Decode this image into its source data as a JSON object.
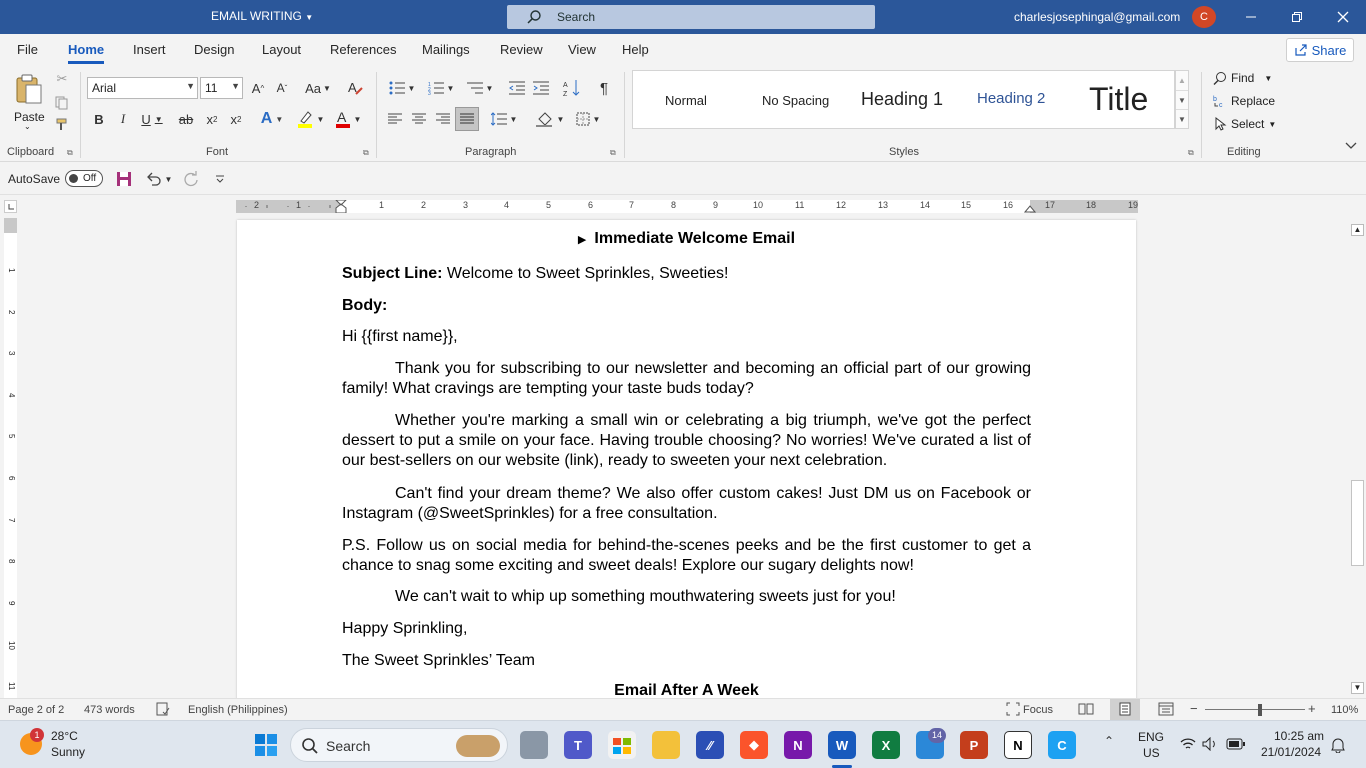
{
  "title_bar": {
    "doc_title": "EMAIL WRITING",
    "search_placeholder": "Search",
    "account_email": "charlesjosephingal@gmail.com",
    "avatar_initial": "C"
  },
  "menu": {
    "tabs": [
      "File",
      "Home",
      "Insert",
      "Design",
      "Layout",
      "References",
      "Mailings",
      "Review",
      "View",
      "Help"
    ],
    "active": "Home",
    "share_label": "Share"
  },
  "ribbon": {
    "clipboard": {
      "paste_label": "Paste",
      "group_label": "Clipboard"
    },
    "font": {
      "family": "Arial",
      "size": "11",
      "group_label": "Font"
    },
    "paragraph": {
      "group_label": "Paragraph"
    },
    "styles": {
      "items": [
        "Normal",
        "No Spacing",
        "Heading 1",
        "Heading 2",
        "Title"
      ],
      "group_label": "Styles"
    },
    "editing": {
      "find": "Find",
      "replace": "Replace",
      "select": "Select",
      "group_label": "Editing"
    }
  },
  "qat": {
    "autosave_label": "AutoSave",
    "autosave_state": "Off"
  },
  "ruler": {
    "numbers": [
      "2",
      "1",
      "",
      "1",
      "2",
      "3",
      "4",
      "5",
      "6",
      "7",
      "8",
      "9",
      "10",
      "11",
      "12",
      "13",
      "14",
      "15",
      "16",
      "17",
      "18",
      "19"
    ]
  },
  "vruler": {
    "numbers": [
      "1",
      "2",
      "3",
      "4",
      "5",
      "6",
      "7",
      "8",
      "9",
      "10",
      "11"
    ]
  },
  "document": {
    "heading_top": "Immediate Welcome Email",
    "subject_label": "Subject Line:",
    "subject_text": " Welcome to Sweet Sprinkles, Sweeties!",
    "body_label": "Body:",
    "greeting": "Hi {{first name}},",
    "p1": "Thank you for subscribing to our newsletter and becoming an official part of our growing family! What cravings are tempting your taste buds today?",
    "p2": "Whether you're marking a small win or celebrating a big triumph, we've got the perfect dessert to put a smile on your face. Having trouble choosing? No worries! We've curated a list of our best-sellers on our website (link), ready to sweeten your next celebration.",
    "p3": "Can't find your dream theme? We also offer custom cakes! Just DM us on Facebook or Instagram (@SweetSprinkles) for a free consultation.",
    "p4": "P.S. Follow us on social media for behind-the-scenes peeks and be the first customer to get a chance to snag some exciting and sweet deals! Explore our sugary delights now!",
    "p5": "We can't wait to whip up something mouthwatering sweets just for you!",
    "signoff": "Happy Sprinkling,",
    "team": "The Sweet Sprinkles’ Team",
    "heading_next": "Email After A Week"
  },
  "status_bar": {
    "page": "Page 2 of 2",
    "words": "473 words",
    "language": "English (Philippines)",
    "focus": "Focus",
    "zoom": "110%",
    "zoom_fraction": 0.55
  },
  "taskbar": {
    "weather_temp": "28°C",
    "weather_desc": "Sunny",
    "weather_badge": "1",
    "search_label": "Search",
    "lang_top": "ENG",
    "lang_bottom": "US",
    "time": "10:25 am",
    "date": "21/01/2024",
    "teams_badge": "14"
  },
  "colors": {
    "word_blue": "#2b579a",
    "accent": "#185abd",
    "avatar": "#d24726"
  }
}
